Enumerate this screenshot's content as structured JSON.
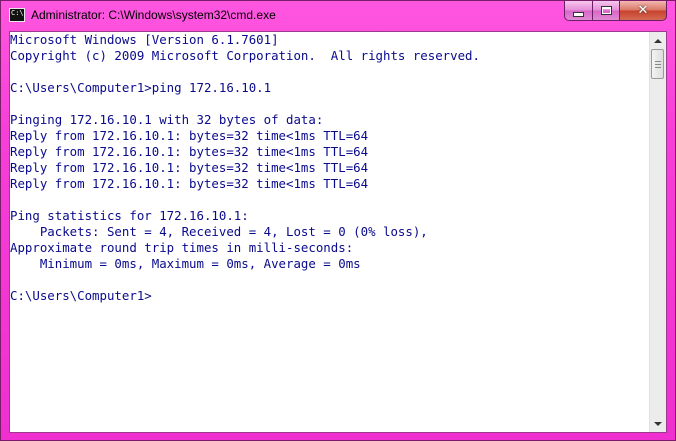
{
  "window": {
    "title": "Administrator: C:\\Windows\\system32\\cmd.exe",
    "icon": "cmd-icon",
    "icon_text": "C:\\",
    "accent_color": "#f63fd8",
    "buttons": {
      "minimize_icon": "minimize-icon",
      "maximize_icon": "maximize-icon",
      "close_icon": "close-icon",
      "close_glyph": "✕"
    }
  },
  "console": {
    "text_color": "#0a0a8c",
    "background": "#ffffff",
    "lines": [
      "Microsoft Windows [Version 6.1.7601]",
      "Copyright (c) 2009 Microsoft Corporation.  All rights reserved.",
      "",
      "C:\\Users\\Computer1>ping 172.16.10.1",
      "",
      "Pinging 172.16.10.1 with 32 bytes of data:",
      "Reply from 172.16.10.1: bytes=32 time<1ms TTL=64",
      "Reply from 172.16.10.1: bytes=32 time<1ms TTL=64",
      "Reply from 172.16.10.1: bytes=32 time<1ms TTL=64",
      "Reply from 172.16.10.1: bytes=32 time<1ms TTL=64",
      "",
      "Ping statistics for 172.16.10.1:",
      "    Packets: Sent = 4, Received = 4, Lost = 0 (0% loss),",
      "Approximate round trip times in milli-seconds:",
      "    Minimum = 0ms, Maximum = 0ms, Average = 0ms",
      "",
      "C:\\Users\\Computer1>"
    ]
  }
}
